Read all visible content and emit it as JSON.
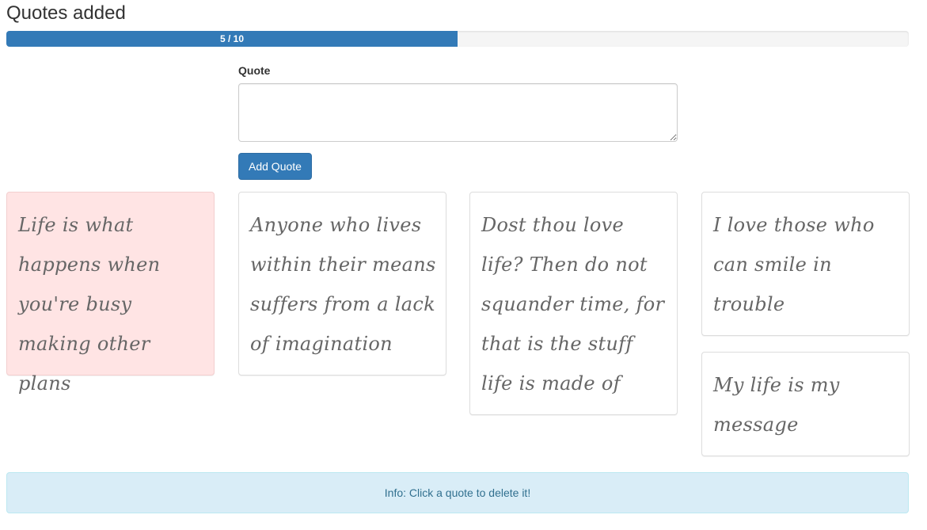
{
  "header": {
    "title": "Quotes added"
  },
  "progress": {
    "label": "5 / 10",
    "current": 5,
    "max": 10,
    "fraction": 0.5,
    "color": "#337ab7"
  },
  "form": {
    "label": "Quote",
    "textarea_value": "",
    "button_label": "Add Quote"
  },
  "quotes": [
    {
      "text": "Life is what happens when you're busy making other plans",
      "highlighted": true
    },
    {
      "text": "Anyone who lives within their means suffers from a lack of imagination",
      "highlighted": false
    },
    {
      "text": "Dost thou love life? Then do not squander time, for that is the stuff life is made of",
      "highlighted": false
    },
    {
      "text": "I love those who can smile in trouble",
      "highlighted": false
    },
    {
      "text": "My life is my message",
      "highlighted": false
    }
  ],
  "info": {
    "text": "Info: Click a quote to delete it!"
  },
  "colors": {
    "primary": "#337ab7",
    "highlight_bg": "#ffe4e4",
    "info_bg": "#d9edf7",
    "info_text": "#31708f"
  }
}
